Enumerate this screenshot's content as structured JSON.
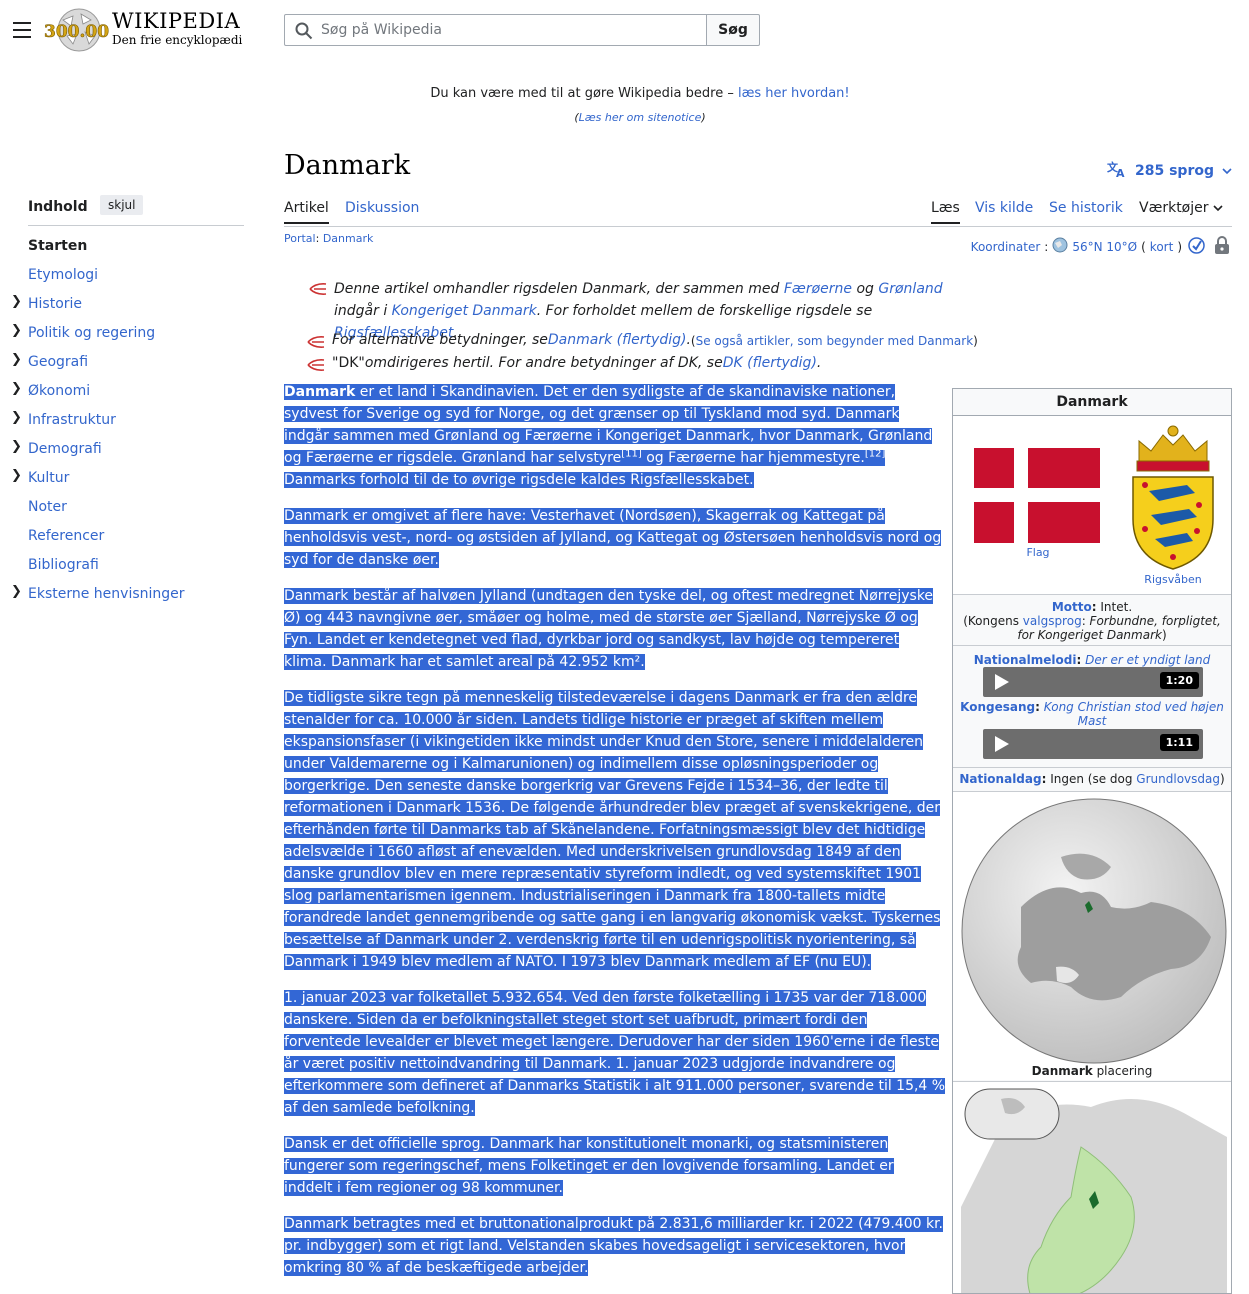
{
  "header": {
    "logo_word": "Wikipedia",
    "logo_tagline": "Den frie encyklopædi",
    "logo_badge": "300.000",
    "search_placeholder": "Søg på Wikipedia",
    "search_button": "Søg"
  },
  "sitenotice": {
    "text": "Du kan være med til at gøre Wikipedia bedre –",
    "link": "læs her hvordan!",
    "sub_open": "(",
    "sub_link": "Læs her om sitenotice",
    "sub_close": ")"
  },
  "page": {
    "title": "Danmark",
    "languages": "285 sprog"
  },
  "tabs": {
    "left": [
      "Artikel",
      "Diskussion"
    ],
    "right": [
      "Læs",
      "Vis kilde",
      "Se historik",
      "Værktøjer"
    ]
  },
  "portal": {
    "label": "Portal",
    "sep": ":",
    "link": "Danmark"
  },
  "coords": {
    "label": "Koordinater",
    "value": "56°N 10°Ø",
    "open": "(",
    "map": "kort",
    "close": ")"
  },
  "toc": {
    "title": "Indhold",
    "hide": "skjul",
    "items": [
      {
        "label": "Starten",
        "expandable": false
      },
      {
        "label": "Etymologi",
        "expandable": false
      },
      {
        "label": "Historie",
        "expandable": true
      },
      {
        "label": "Politik og regering",
        "expandable": true
      },
      {
        "label": "Geografi",
        "expandable": true
      },
      {
        "label": "Økonomi",
        "expandable": true
      },
      {
        "label": "Infrastruktur",
        "expandable": true
      },
      {
        "label": "Demografi",
        "expandable": true
      },
      {
        "label": "Kultur",
        "expandable": true
      },
      {
        "label": "Noter",
        "expandable": false
      },
      {
        "label": "Referencer",
        "expandable": false
      },
      {
        "label": "Bibliografi",
        "expandable": false
      },
      {
        "label": "Eksterne henvisninger",
        "expandable": true
      }
    ]
  },
  "hatnotes": {
    "h1": {
      "a": "Denne artikel omhandler rigsdelen Danmark, der sammen med ",
      "l1": "Færøerne",
      "b": " og ",
      "l2": "Grønland",
      "c": " indgår i ",
      "l3": "Kongeriget Danmark",
      "d": ". For forholdet mellem de forskellige rigsdele se ",
      "l4": "Rigsfællesskabet",
      "e": "."
    },
    "h2": {
      "a": "For alternative betydninger, se ",
      "l1": "Danmark (flertydig)",
      "b": ". ",
      "small_open": "(",
      "small_link": "Se også artikler, som begynder med Danmark",
      "small_close": ")"
    },
    "h3": {
      "a": "\"DK\"",
      "b": " omdirigeres hertil. For andre betydninger af DK, se ",
      "l1": "DK (flertydig)",
      "c": "."
    }
  },
  "paragraphs": {
    "p1": {
      "bold": "Danmark",
      "a": " er et land i Skandinavien. Det er den sydligste af de skandinaviske nationer, sydvest for Sverige og syd for Norge, og det grænser op til Tyskland mod syd. Danmark indgår sammen med Grønland og Færøerne i Kongeriget Danmark, hvor Danmark, Grønland og Færøerne er rigsdele. Grønland har selvstyre",
      "ref1": "[11]",
      "b": " og Færøerne har hjemmestyre.",
      "ref2": "[12]",
      "c": " Danmarks forhold til de to øvrige rigsdele kaldes Rigsfællesskabet."
    },
    "p2": "Danmark er omgivet af flere have: Vesterhavet (Nordsøen), Skagerrak og Kattegat på henholdsvis vest-, nord- og østsiden af Jylland, og Kattegat og Østersøen henholdsvis nord og syd for de danske øer.",
    "p3": "Danmark består af halvøen Jylland (undtagen den tyske del, og oftest medregnet Nørrejyske Ø) og 443 navngivne øer, småøer og holme, med de største øer Sjælland, Nørrejyske Ø og Fyn. Landet er kendetegnet ved flad, dyrkbar jord og sandkyst, lav højde og tempereret klima. Danmark har et samlet areal på 42.952 km².",
    "p4": "De tidligste sikre tegn på menneskelig tilstedeværelse i dagens Danmark er fra den ældre stenalder for ca. 10.000 år siden. Landets tidlige historie er præget af skiften mellem ekspansionsfaser (i vikingetiden ikke mindst under Knud den Store, senere i middelalderen under Valdemarerne og i Kalmarunionen) og indimellem disse opløsningsperioder og borgerkrige. Den seneste danske borgerkrig var Grevens Fejde i 1534–36, der ledte til reformationen i Danmark 1536. De følgende århundreder blev præget af svenskekrigene, der efterhånden førte til Danmarks tab af Skånelandene. Forfatningsmæssigt blev det hidtidige adelsvælde i 1660 afløst af enevælden. Med underskrivelsen grundlovsdag 1849 af den danske grundlov blev en mere repræsentativ styreform indledt, og ved systemskiftet 1901 slog parlamentarismen igennem. Industrialiseringen i Danmark fra 1800-tallets midte forandrede landet gennemgribende og satte gang i en langvarig økonomisk vækst. Tyskernes besættelse af Danmark under 2. verdenskrig førte til en udenrigspolitisk nyorientering, så Danmark i 1949 blev medlem af NATO. I 1973 blev Danmark medlem af EF (nu EU).",
    "p5": "1. januar 2023 var folketallet 5.932.654. Ved den første folketælling i 1735 var der 718.000 danskere. Siden da er befolkningstallet steget stort set uafbrudt, primært fordi den forventede levealder er blevet meget længere. Derudover har der siden 1960'erne i de fleste år været positiv nettoindvandring til Danmark. 1. januar 2023 udgjorde indvandrere og efterkommere som defineret af Danmarks Statistik i alt 911.000 personer, svarende til 15,4 % af den samlede befolkning.",
    "p6": "Dansk er det officielle sprog. Danmark har konstitutionelt monarki, og statsministeren fungerer som regeringschef, mens Folketinget er den lovgivende forsamling. Landet er inddelt i fem regioner og 98 kommuner.",
    "p7": "Danmark betragtes med et bruttonationalprodukt på 2.831,6 milliarder kr. i 2022 (479.400 kr. pr. indbygger) som et rigt land. Velstanden skabes hovedsageligt i servicesektoren, hvor omkring 80 % af de beskæftigede arbejder."
  },
  "infobox": {
    "title": "Danmark",
    "flag_caption": "Flag",
    "coa_caption": "Rigsvåben",
    "motto_label": "Motto",
    "motto_colon": ":",
    "motto_value": " Intet.",
    "motto_note_a": "(Kongens ",
    "motto_note_link": "valgsprog",
    "motto_note_b": ": ",
    "motto_note_italic": "Forbundne, forpligtet, for Kongeriget Danmark",
    "motto_note_c": ")",
    "anthem_label": "Nationalmelodi",
    "anthem_colon": ":",
    "anthem_value": "Der er et yndigt land",
    "anthem_time": "1:20",
    "royal_label": "Kongesang",
    "royal_colon": ":",
    "royal_value": "Kong Christian stod ved højen Mast",
    "royal_time": "1:11",
    "natday_label": "Nationaldag",
    "natday_colon": ":",
    "natday_value": " Ingen (se dog ",
    "natday_link": "Grundlovsdag",
    "natday_close": ")",
    "map_caption_bold": "Danmark",
    "map_caption_rest": " placering"
  },
  "colors": {
    "link": "#3366cc",
    "selection": "#3367d5",
    "flag_red": "#c8102e"
  }
}
